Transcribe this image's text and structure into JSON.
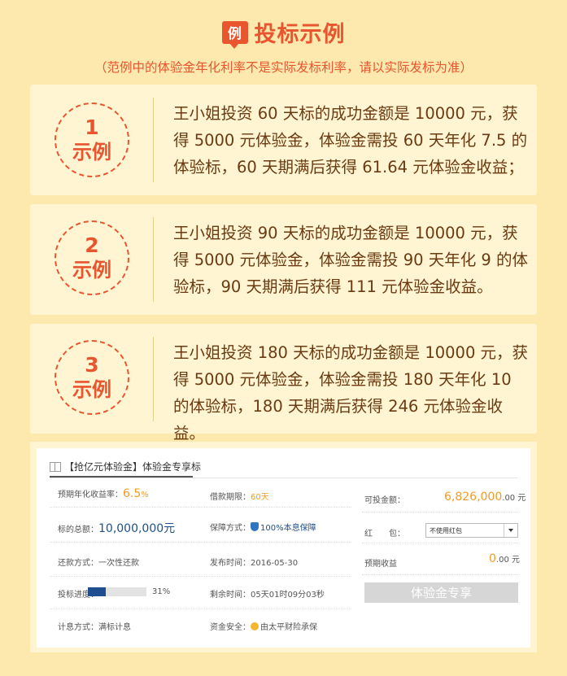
{
  "header": {
    "badge": "例",
    "title": "投标示例",
    "subtitle": "（范例中的体验金年化利率不是实际发标利率，请以实际发标为准）"
  },
  "examples": [
    {
      "number": "1",
      "label": "示例",
      "text": "王小姐投资 60 天标的成功金额是 10000 元，获得 5000 元体验金，体验金需投 60 天年化 7.5 的体验标，60 天期满后获得 61.64 元体验金收益；"
    },
    {
      "number": "2",
      "label": "示例",
      "text": "王小姐投资 90 天标的成功金额是 10000 元，获得 5000 元体验金，体验金需投 90 天年化 9 的体验标，90 天期满后获得 111 元体验金收益。"
    },
    {
      "number": "3",
      "label": "示例",
      "text": "王小姐投资 180 天标的成功金额是 10000 元，获得 5000 元体验金，体验金需投 180 天年化 10 的体验标，180 天期满后获得 246 元体验金收益。"
    }
  ],
  "screenshot": {
    "heading": "【抢亿元体验金】体验金专享标",
    "icon": "gift-icon",
    "rate_label": "预期年化收益率：",
    "rate_value": "6.5",
    "rate_unit": "%",
    "term_label": "借款期限：",
    "term_value": "60天",
    "available_label": "可投金额：",
    "available_value": "6,826,000",
    "available_unit": ".00 元",
    "total_label": "标的总额：",
    "total_value": "10,000,000元",
    "guarantee_label": "保障方式：",
    "guarantee_value": "100%本息保障",
    "redpack_label": "红　　包：",
    "redpack_select": "不使用红包",
    "repay_label": "还款方式：",
    "repay_value": "一次性还款",
    "publish_label": "发布时间：",
    "publish_value": "2016-05-30",
    "expected_label": "预期收益",
    "expected_value": "0",
    "expected_unit": ".00 元",
    "progress_label": "投标进度：",
    "progress_percent": "31%",
    "progress_fraction": 0.31,
    "remaining_label": "剩余时间：",
    "remaining_value": "05天01时09分03秒",
    "button_label": "体验金专享",
    "interest_label": "计息方式：",
    "interest_value": "满标计息",
    "security_label": "资金安全：",
    "security_value": "由太平财险承保"
  },
  "colors": {
    "accent": "#e8552f",
    "background": "#fde9ae",
    "card": "#fff5d2",
    "text": "#6b3a10",
    "orange": "#f39b1e",
    "navy": "#1f4f8f"
  }
}
